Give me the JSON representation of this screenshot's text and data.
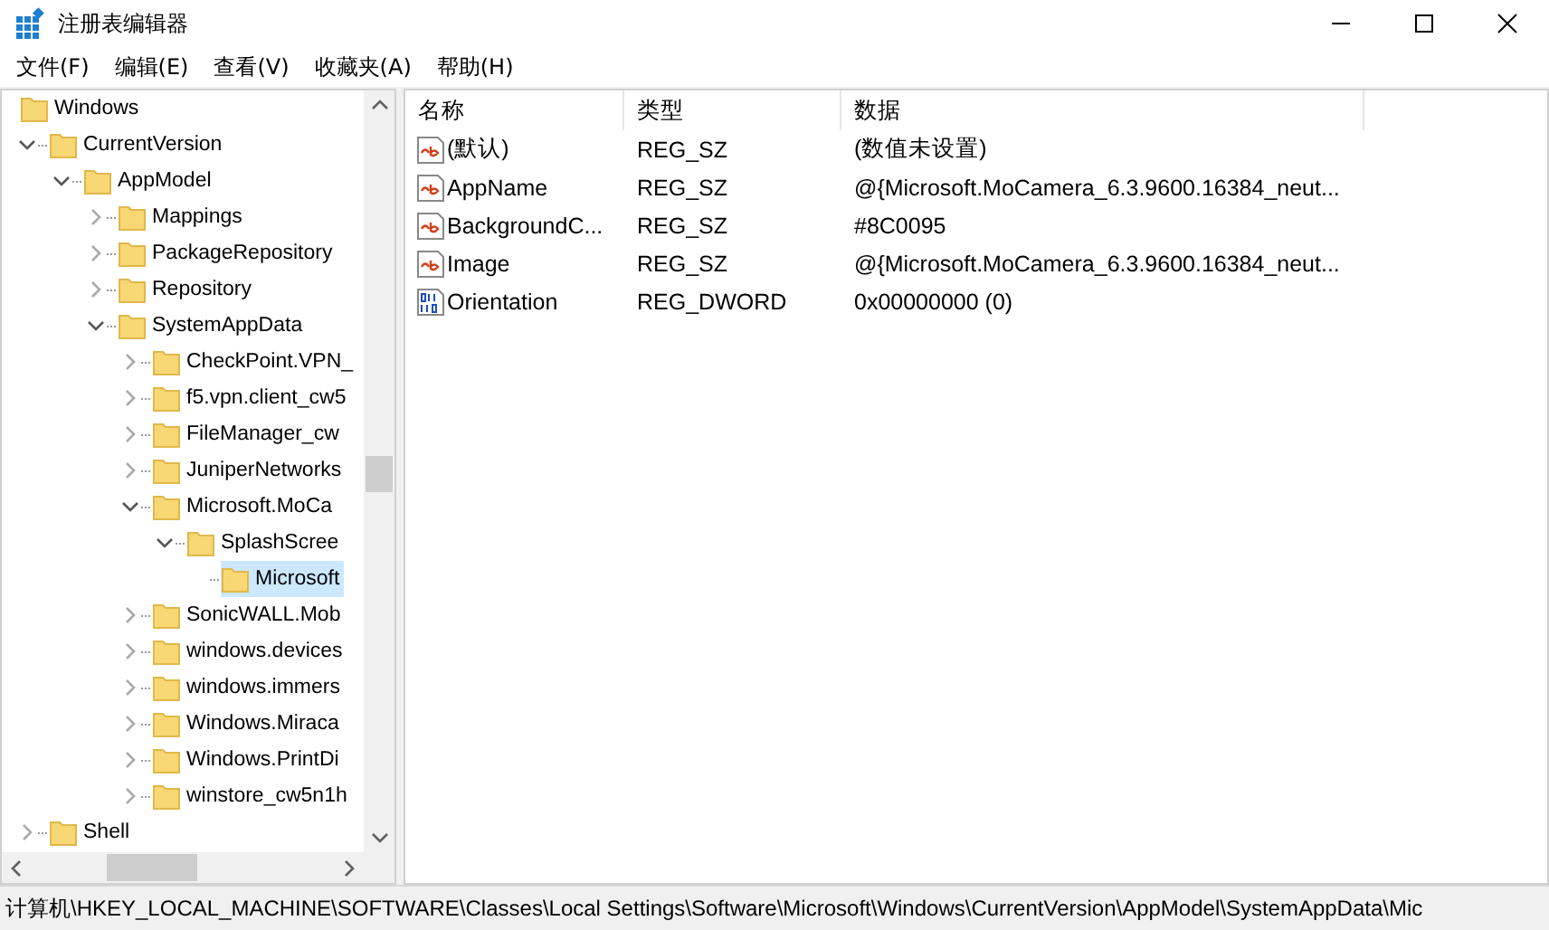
{
  "window": {
    "title": "注册表编辑器"
  },
  "menu": [
    "文件(F)",
    "编辑(E)",
    "查看(V)",
    "收藏夹(A)",
    "帮助(H)"
  ],
  "tree": [
    {
      "label": "Windows",
      "selected": false,
      "children": [
        {
          "label": "CurrentVersion",
          "selected": false,
          "expanded": true,
          "children": [
            {
              "label": "AppModel",
              "selected": false,
              "expanded": true,
              "children": [
                {
                  "label": "Mappings",
                  "selected": false,
                  "expanded": false
                },
                {
                  "label": "PackageRepository",
                  "selected": false,
                  "expanded": false
                },
                {
                  "label": "Repository",
                  "selected": false,
                  "expanded": false
                },
                {
                  "label": "SystemAppData",
                  "selected": false,
                  "expanded": true,
                  "children": [
                    {
                      "label": "CheckPoint.VPN_",
                      "selected": false,
                      "expanded": false
                    },
                    {
                      "label": "f5.vpn.client_cw5",
                      "selected": false,
                      "expanded": false
                    },
                    {
                      "label": "FileManager_cw",
                      "selected": false,
                      "expanded": false
                    },
                    {
                      "label": "JuniperNetworks",
                      "selected": false,
                      "expanded": false
                    },
                    {
                      "label": "Microsoft.MoCa",
                      "selected": false,
                      "expanded": true,
                      "children": [
                        {
                          "label": "SplashScree",
                          "selected": false,
                          "expanded": true,
                          "children": [
                            {
                              "label": "Microsoft",
                              "selected": true
                            }
                          ]
                        }
                      ]
                    },
                    {
                      "label": "SonicWALL.Mob",
                      "selected": false,
                      "expanded": false
                    },
                    {
                      "label": "windows.devices",
                      "selected": false,
                      "expanded": false
                    },
                    {
                      "label": "windows.immers",
                      "selected": false,
                      "expanded": false
                    },
                    {
                      "label": "Windows.Miraca",
                      "selected": false,
                      "expanded": false
                    },
                    {
                      "label": "Windows.PrintDi",
                      "selected": false,
                      "expanded": false
                    },
                    {
                      "label": "winstore_cw5n1h",
                      "selected": false,
                      "expanded": false
                    }
                  ]
                }
              ]
            }
          ]
        },
        {
          "label": "Shell",
          "selected": false,
          "expanded": false
        }
      ]
    }
  ],
  "table": {
    "columns": [
      "名称",
      "类型",
      "数据"
    ],
    "rows": [
      {
        "kind": "string",
        "name": "(默认)",
        "type": "REG_SZ",
        "data": "(数值未设置)"
      },
      {
        "kind": "string",
        "name": "AppName",
        "type": "REG_SZ",
        "data": "@{Microsoft.MoCamera_6.3.9600.16384_neut..."
      },
      {
        "kind": "string",
        "name": "BackgroundC...",
        "type": "REG_SZ",
        "data": "#8C0095"
      },
      {
        "kind": "string",
        "name": "Image",
        "type": "REG_SZ",
        "data": "@{Microsoft.MoCamera_6.3.9600.16384_neut..."
      },
      {
        "kind": "dword",
        "name": "Orientation",
        "type": "REG_DWORD",
        "data": "0x00000000 (0)"
      }
    ]
  },
  "status_bar": "计算机\\HKEY_LOCAL_MACHINE\\SOFTWARE\\Classes\\Local Settings\\Software\\Microsoft\\Windows\\CurrentVersion\\AppModel\\SystemAppData\\Mic"
}
